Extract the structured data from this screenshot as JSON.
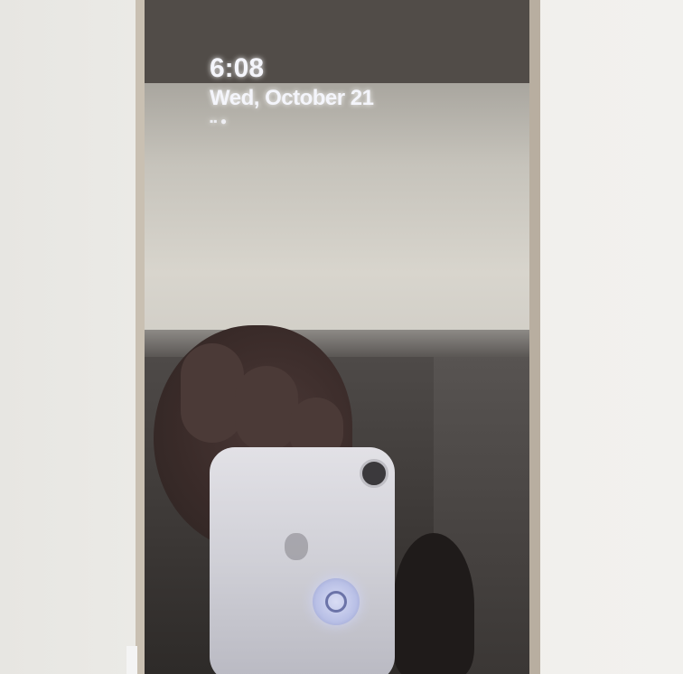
{
  "lock_screen": {
    "time": "6:08",
    "date": "Wed, October 21",
    "status": "▪▪ ●"
  },
  "colors": {
    "screen_dark": "#2b2725",
    "glare": "#d0cdc6",
    "text_glow": "#f4f5fb",
    "unlock_ring": "#b9c0e6"
  }
}
